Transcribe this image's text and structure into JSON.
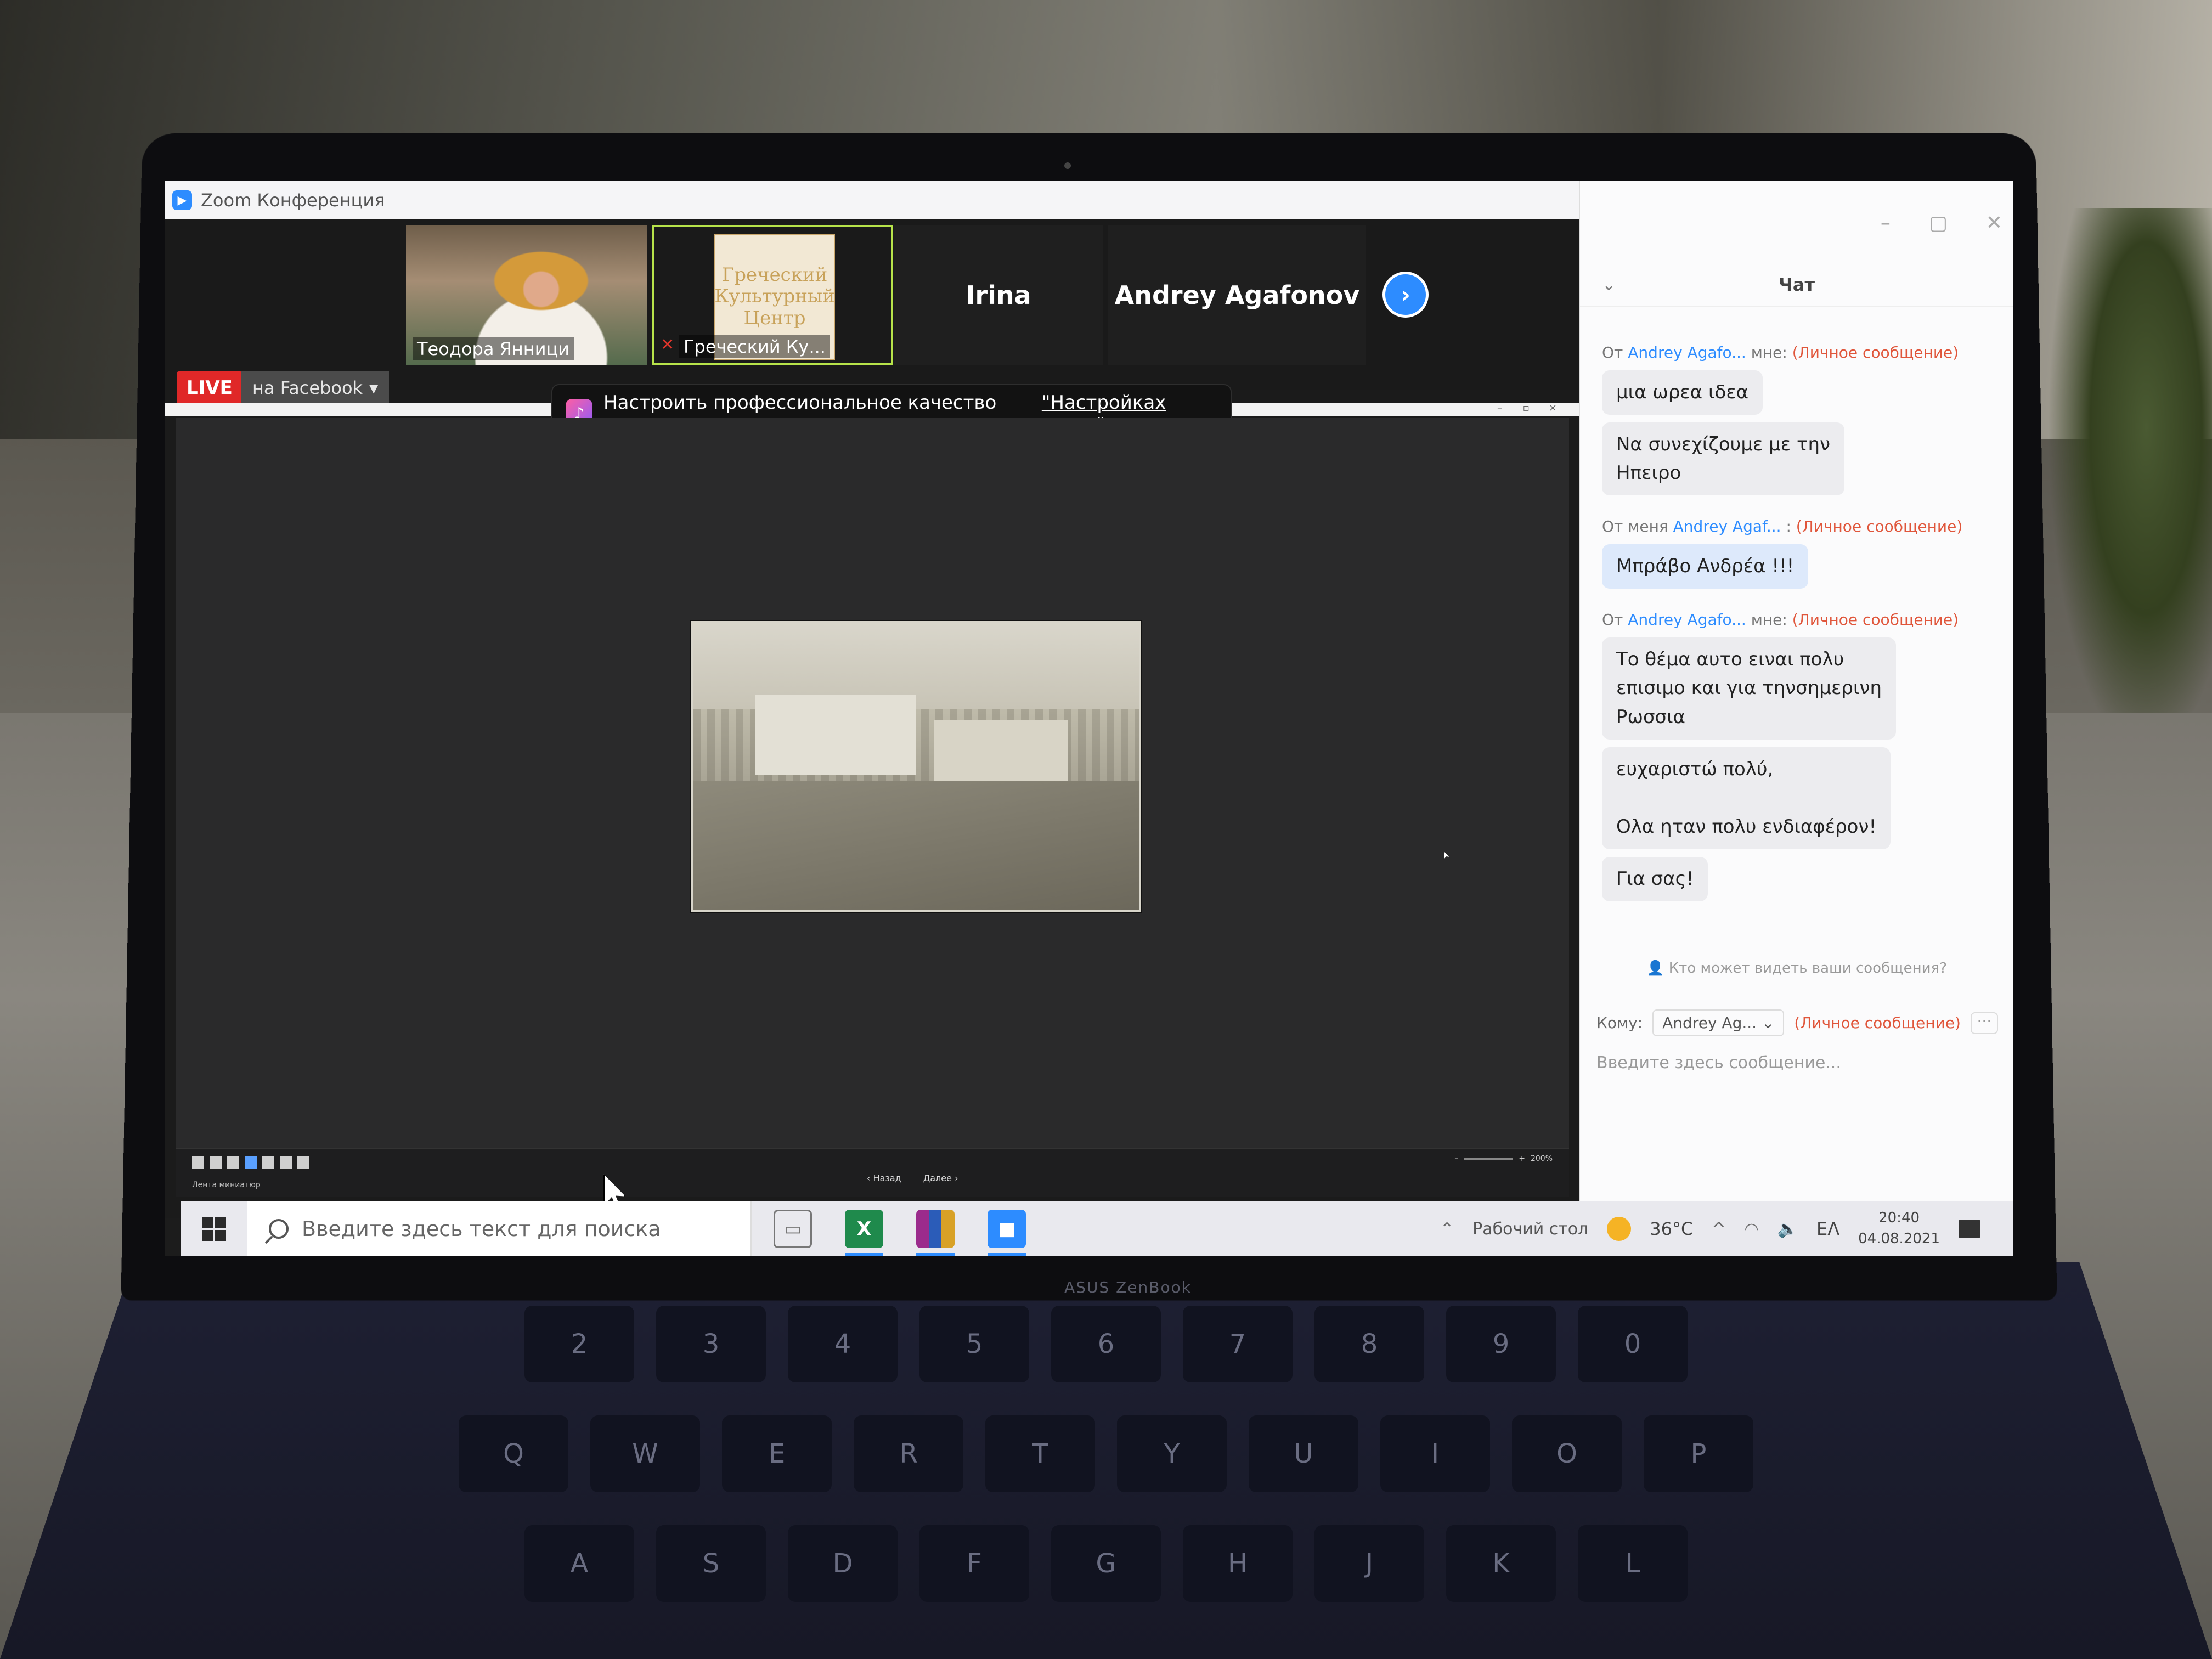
{
  "window": {
    "title": "Zoom Конференция"
  },
  "participants": [
    {
      "name": "Теодора Янници"
    },
    {
      "name": "Греческий Ку...",
      "logo_lines": [
        "Греческий",
        "Культурный",
        "Центр"
      ]
    },
    {
      "name": "Irina"
    },
    {
      "name": "Andrey Agafonov"
    }
  ],
  "live": {
    "badge": "LIVE",
    "target": "на Facebook"
  },
  "notification": {
    "text": "Настроить профессиональное качество звука в ",
    "link": "\"Настройках звука\""
  },
  "presentation": {
    "label": "Лента миниатюр",
    "prev": "‹ Назад",
    "next": "Далее ›",
    "zoom": "200%"
  },
  "chat": {
    "title": "Чат",
    "messages": [
      {
        "prefix": "От",
        "who": "Andrey Agafo...",
        "to": "мне:",
        "priv": "(Личное сообщение)",
        "bubbles": [
          "μια ωρεα ιδεα",
          "Να συνεχίζουμε  με την\nΗπειρο"
        ]
      },
      {
        "prefix": "От меня",
        "who": "Andrey Agaf...",
        "to": ":",
        "priv": "(Личное сообщение)",
        "bubbles": [
          "Μπράβο Ανδρέα !!!"
        ]
      },
      {
        "prefix": "От",
        "who": "Andrey Agafo...",
        "to": "мне:",
        "priv": "(Личное сообщение)",
        "bubbles": [
          "Το θέμα αυτο ειναι πολυ\nεπισιμο και για τηνσημερινη\nΡωσσια",
          "ευχαριστώ πολύ,\n\nΟλα ηταν πολυ ενδιαφέρον!",
          "Για σας!"
        ]
      }
    ],
    "visibility": "Кто может видеть ваши сообщения?",
    "to_label": "Кому:",
    "to_value": "Andrey Ag...",
    "to_priv": "(Личное сообщение)",
    "more": "···",
    "input_placeholder": "Введите здесь сообщение..."
  },
  "taskbar": {
    "search_placeholder": "Введите здесь текст для поиска",
    "desktop_label": "Рабочий стол",
    "temperature": "36°C",
    "lang": "EΛ",
    "time": "20:40",
    "date": "04.08.2021"
  },
  "laptop": {
    "brand": "ASUS ZenBook"
  },
  "colors": {
    "zoom_blue": "#2d8cff",
    "live_red": "#e02828",
    "private_msg": "#e0563b"
  }
}
